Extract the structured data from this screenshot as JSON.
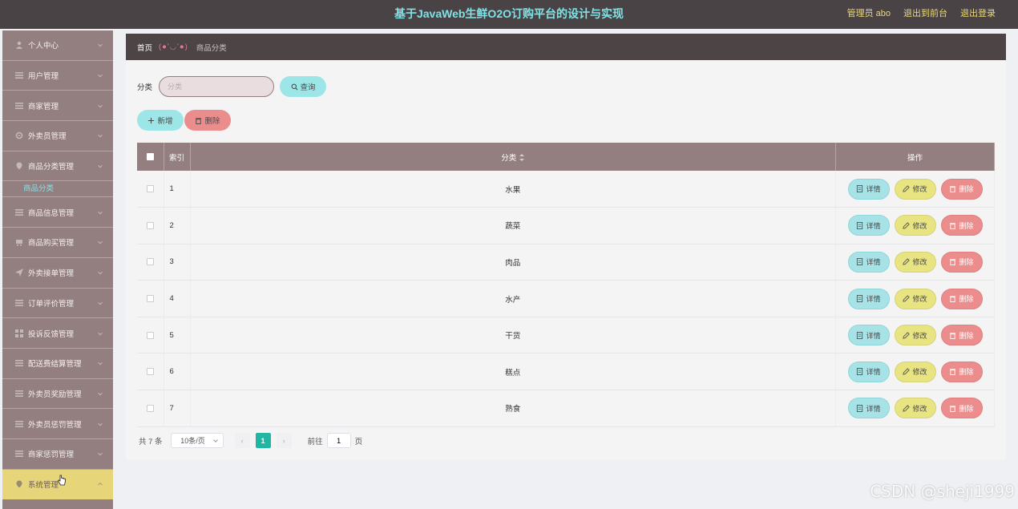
{
  "header": {
    "title": "基于JavaWeb生鲜O2O订购平台的设计与实现",
    "admin_label": "管理员 abo",
    "to_front": "退出到前台",
    "logout": "退出登录"
  },
  "sidebar": {
    "items": [
      {
        "label": "个人中心"
      },
      {
        "label": "用户管理"
      },
      {
        "label": "商家管理"
      },
      {
        "label": "外卖员管理"
      },
      {
        "label": "商品分类管理"
      },
      {
        "label": "商品信息管理"
      },
      {
        "label": "商品购买管理"
      },
      {
        "label": "外卖接单管理"
      },
      {
        "label": "订单评价管理"
      },
      {
        "label": "投诉反馈管理"
      },
      {
        "label": "配送费结算管理"
      },
      {
        "label": "外卖员奖励管理"
      },
      {
        "label": "外卖员惩罚管理"
      },
      {
        "label": "商家惩罚管理"
      },
      {
        "label": "系统管理"
      }
    ],
    "submenu": "商品分类"
  },
  "breadcrumb": {
    "home": "首页",
    "separator": "(●'◡'●)",
    "current": "商品分类"
  },
  "search": {
    "label": "分类",
    "placeholder": "分类",
    "button": "查询"
  },
  "actions": {
    "add": "新增",
    "delete": "删除"
  },
  "table": {
    "columns": [
      "索引",
      "分类",
      "操作"
    ],
    "rows": [
      {
        "index": "1",
        "category": "水果"
      },
      {
        "index": "2",
        "category": "蔬菜"
      },
      {
        "index": "3",
        "category": "肉品"
      },
      {
        "index": "4",
        "category": "水产"
      },
      {
        "index": "5",
        "category": "干货"
      },
      {
        "index": "6",
        "category": "糕点"
      },
      {
        "index": "7",
        "category": "熟食"
      }
    ],
    "row_actions": {
      "detail": "详情",
      "edit": "修改",
      "delete": "删除"
    }
  },
  "pagination": {
    "total": "共 7 条",
    "page_size": "10条/页",
    "current_page": "1",
    "goto_prefix": "前往",
    "goto_value": "1",
    "goto_suffix": "页"
  },
  "watermark": "CSDN @sheji1999",
  "colors": {
    "topbar": "#4a4345",
    "sidebar": "#947f80",
    "accent_cyan": "#9de6e8",
    "accent_yellow": "#e8e482",
    "accent_red": "#ec8d8d",
    "page_active": "#1fb7a4"
  }
}
